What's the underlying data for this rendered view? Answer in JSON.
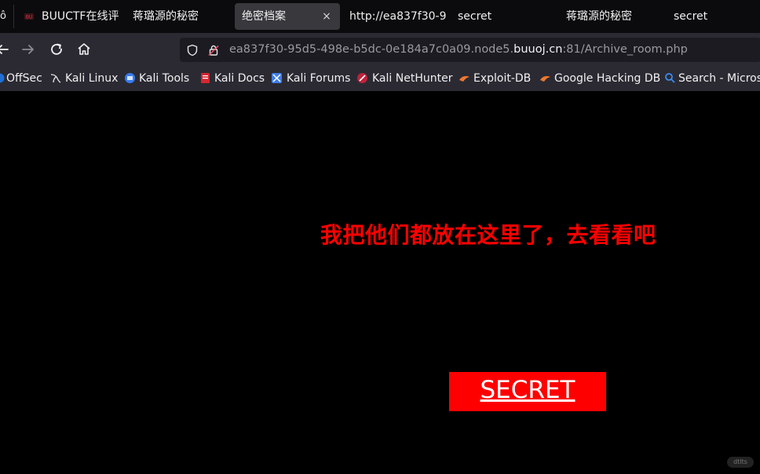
{
  "tabs": [
    {
      "label": "BUUCTF在线评",
      "active": false
    },
    {
      "label": "蒋璐源的秘密",
      "active": false
    },
    {
      "label": "绝密档案",
      "active": true
    },
    {
      "label": "http://ea837f30-9",
      "active": false
    },
    {
      "label": "secret",
      "active": false
    },
    {
      "label": "蒋璐源的秘密",
      "active": false
    },
    {
      "label": "secret",
      "active": false
    }
  ],
  "tab_edge_label": "ô",
  "active_tab_close": "×",
  "urlbar": {
    "prefix": "ea837f30-95d5-498e-b5dc-0e184a7c0a09.node5.",
    "domain": "buuoj.cn",
    "suffix": ":81/Archive_room.php"
  },
  "bookmarks": [
    {
      "label": "OffSec",
      "icon": "offsec-icon"
    },
    {
      "label": "Kali Linux",
      "icon": "kali-dragon-icon"
    },
    {
      "label": "Kali Tools",
      "icon": "kali-tools-icon"
    },
    {
      "label": "Kali Docs",
      "icon": "kali-docs-icon"
    },
    {
      "label": "Kali Forums",
      "icon": "kali-forums-icon"
    },
    {
      "label": "Kali NetHunter",
      "icon": "nethunter-icon"
    },
    {
      "label": "Exploit-DB",
      "icon": "exploit-db-icon"
    },
    {
      "label": "Google Hacking DB",
      "icon": "ghdb-icon"
    },
    {
      "label": "Search - Microso",
      "icon": "search-icon"
    }
  ],
  "page": {
    "headline": "我把他们都放在这里了，去看看吧",
    "button_label": "SECRET",
    "corner_badge": "dtlts"
  },
  "colors": {
    "headline": "#ff0000",
    "button_bg": "#ff0000",
    "button_text": "#ffffff",
    "page_bg": "#000000",
    "toolbar_bg": "#2b2a33",
    "tabbar_bg": "#0b0b0d"
  }
}
